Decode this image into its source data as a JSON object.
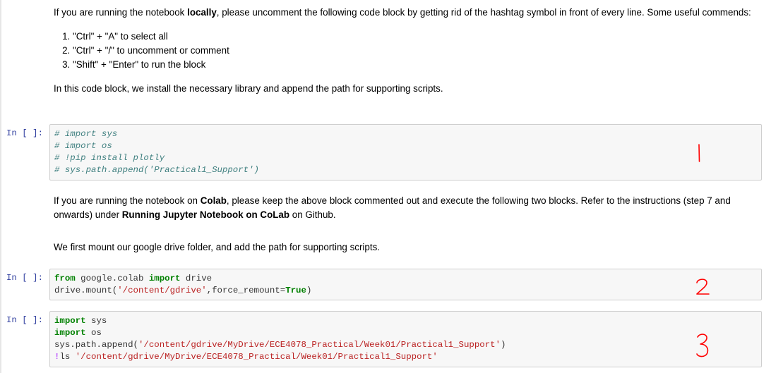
{
  "markdown1": {
    "para1_prefix": "If you are running the notebook ",
    "para1_bold": "locally",
    "para1_suffix": ", please uncomment the following code block by getting rid of the hashtag symbol in front of every line. Some useful commends:",
    "list": [
      "\"Ctrl\" + \"A\" to select all",
      "\"Ctrl\" + \"/\" to uncomment or comment",
      "\"Shift\" + \"Enter\" to run the block"
    ],
    "para2": "In this code block, we install the necessary library and append the path for supporting scripts."
  },
  "cell1": {
    "prompt": "In [ ]:",
    "lines": [
      "# import sys",
      "# import os",
      "# !pip install plotly",
      "# sys.path.append('Practical1_Support')"
    ],
    "annotation": "1"
  },
  "markdown2": {
    "para1_prefix": "If you are running the notebook on ",
    "para1_bold1": "Colab",
    "para1_mid": ", please keep the above block commented out and execute the following two blocks. Refer to the instructions (step 7 and onwards) under ",
    "para1_bold2": "Running Jupyter Notebook on CoLab",
    "para1_suffix": " on Github.",
    "para2": "We first mount our google drive folder, and add the path for supporting scripts."
  },
  "cell2": {
    "prompt": "In [ ]:",
    "line1": {
      "kw1": "from",
      "mid": " google.colab ",
      "kw2": "import",
      "end": " drive"
    },
    "line2": {
      "pre": "drive.mount(",
      "str": "'/content/gdrive'",
      "mid": ",force_remount=",
      "kw": "True",
      "end": ")"
    },
    "annotation": "2"
  },
  "cell3": {
    "prompt": "In [ ]:",
    "line1": {
      "kw": "import",
      "end": " sys"
    },
    "line2": {
      "kw": "import",
      "end": " os"
    },
    "line3": {
      "pre": "sys.path.append(",
      "str": "'/content/gdrive/MyDrive/ECE4078_Practical/Week01/Practical1_Support'",
      "end": ")"
    },
    "line4": {
      "bang": "!",
      "cmd": "ls ",
      "str": "'/content/gdrive/MyDrive/ECE4078_Practical/Week01/Practical1_Support'"
    },
    "annotation": "3"
  },
  "colors": {
    "prompt": "#303f9f",
    "comment": "#408080",
    "keyword": "#008000",
    "string": "#ba2121",
    "annotation": "#ff0000",
    "cell_bg": "#f7f7f7"
  }
}
